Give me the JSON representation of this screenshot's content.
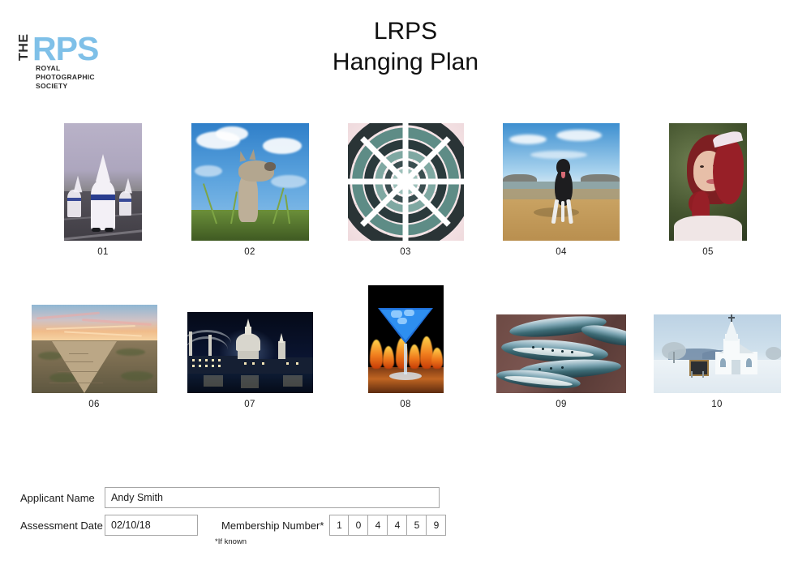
{
  "logo": {
    "the": "THE",
    "rps": "RPS",
    "subtitle": "ROYAL\nPHOTOGRAPHIC\nSOCIETY",
    "accent_color": "#7fc0e8",
    "text_color": "#2b2b2b"
  },
  "header": {
    "title_line_1": "LRPS",
    "title_line_2": "Hanging Plan"
  },
  "photos": [
    {
      "caption": "01",
      "subject": "procession of penitents in white robes with blue sash",
      "orientation": "portrait",
      "width": 96,
      "height": 145
    },
    {
      "caption": "02",
      "subject": "llama looking up against blue sky with clouds",
      "orientation": "landscape",
      "width": 145,
      "height": 145
    },
    {
      "caption": "03",
      "subject": "abstract radial architecture spiral in teal and white",
      "orientation": "square",
      "width": 143,
      "height": 145
    },
    {
      "caption": "04",
      "subject": "black and white dog running on a sandy beach",
      "orientation": "landscape",
      "width": 144,
      "height": 145
    },
    {
      "caption": "05",
      "subject": "portrait of a bride with red hair and tiara",
      "orientation": "portrait",
      "width": 96,
      "height": 145
    },
    {
      "caption": "06",
      "subject": "wooden boardwalk across marshland at sunset",
      "orientation": "landscape",
      "width": 155,
      "height": 109
    },
    {
      "caption": "07",
      "subject": "St Pauls Cathedral and Millennium Bridge at night",
      "orientation": "landscape",
      "width": 155,
      "height": 100
    },
    {
      "caption": "08",
      "subject": "blue martini cocktail above flames",
      "orientation": "portrait",
      "width": 93,
      "height": 133
    },
    {
      "caption": "09",
      "subject": "fresh mackerel fish on a fishmongers slab",
      "orientation": "landscape",
      "width": 160,
      "height": 97
    },
    {
      "caption": "10",
      "subject": "white country church in a snowy winter landscape",
      "orientation": "landscape",
      "width": 157,
      "height": 97
    }
  ],
  "form": {
    "applicant_name_label": "Applicant Name",
    "applicant_name_value": "Andy Smith",
    "assessment_date_label": "Assessment Date",
    "assessment_date_value": "02/10/18",
    "membership_number_label": "Membership Number*",
    "membership_number_digits": [
      "1",
      "0",
      "4",
      "4",
      "5",
      "9"
    ],
    "footnote": "*If known"
  }
}
